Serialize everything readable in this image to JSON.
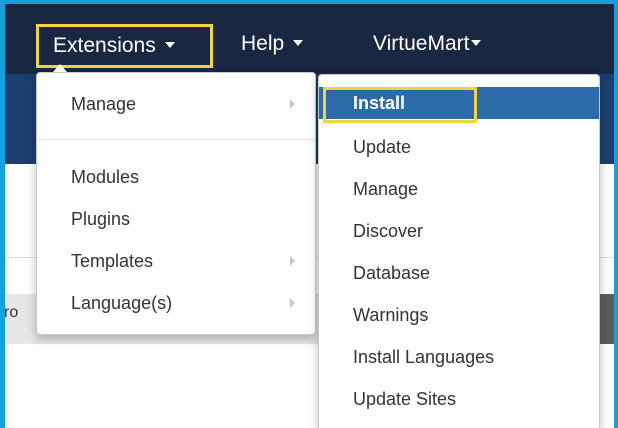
{
  "nav": {
    "extensions": "Extensions",
    "help": "Help",
    "virtuemart": "VirtueMart"
  },
  "extensions_menu": {
    "items": [
      {
        "label": "Manage",
        "submenu": true
      },
      {
        "label": "Modules",
        "submenu": false
      },
      {
        "label": "Plugins",
        "submenu": false
      },
      {
        "label": "Templates",
        "submenu": true
      },
      {
        "label": "Language(s)",
        "submenu": true
      }
    ]
  },
  "manage_submenu": {
    "items": [
      {
        "label": "Install",
        "active": true
      },
      {
        "label": "Update"
      },
      {
        "label": "Manage"
      },
      {
        "label": "Discover"
      },
      {
        "label": "Database"
      },
      {
        "label": "Warnings"
      },
      {
        "label": "Install Languages"
      },
      {
        "label": "Update Sites"
      }
    ]
  },
  "background": {
    "cut_text": "ro"
  },
  "colors": {
    "frame_border": "#14a2dc",
    "topbar": "#1a2743",
    "subbar": "#1c3f6f",
    "highlight": "#f1d241",
    "active_item": "#2d6ba8"
  }
}
